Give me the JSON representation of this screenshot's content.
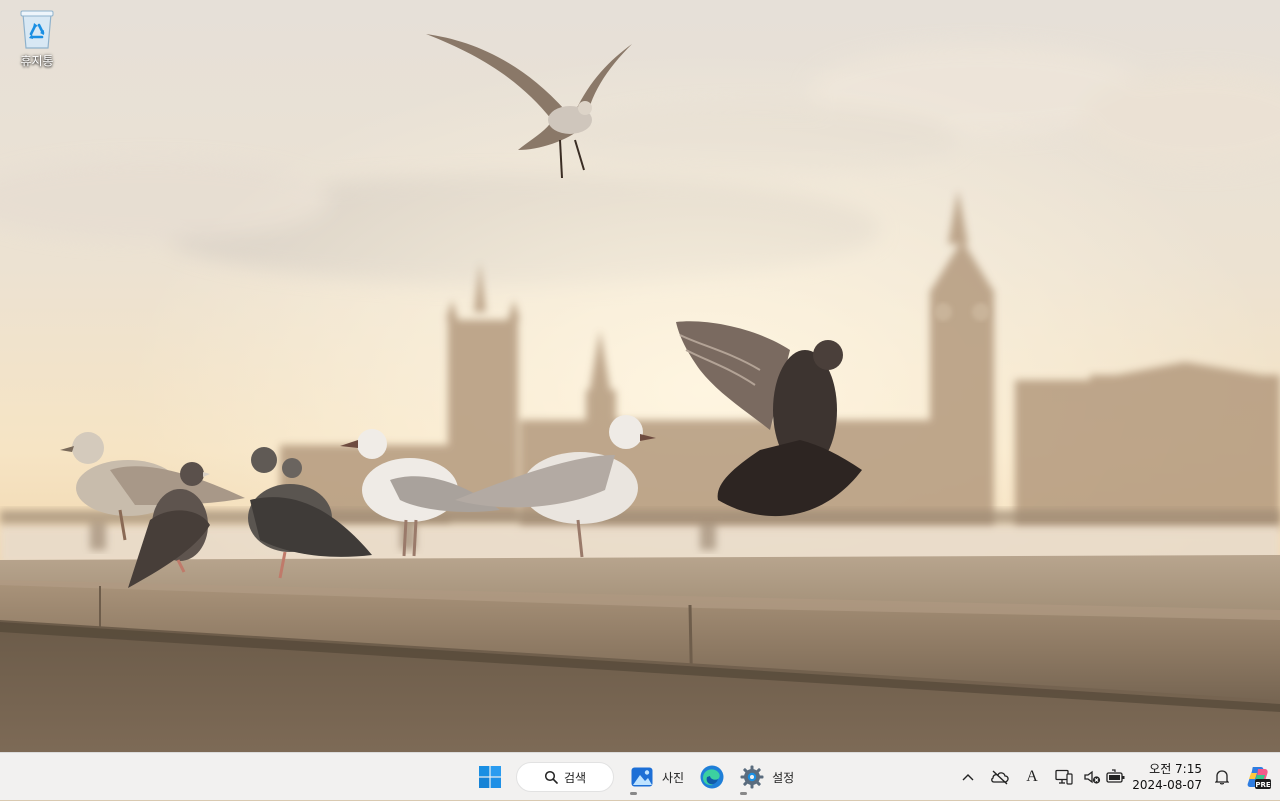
{
  "desktop": {
    "icons": [
      {
        "label": "휴지통",
        "icon": "recycle-bin-icon"
      }
    ],
    "wallpaper": {
      "subject": "pigeons-and-seagulls-on-ledge-with-big-ben",
      "sky_color": "#ece4d8",
      "haze_color": "#f6e2c0",
      "ledge_color": "#9a8a78"
    }
  },
  "taskbar": {
    "start_icon": "windows-start-icon",
    "search": {
      "label": "검색",
      "icon": "search-icon"
    },
    "apps": [
      {
        "label": "사진",
        "icon": "photos-icon",
        "running": true
      },
      {
        "label": "",
        "icon": "edge-icon",
        "running": false
      },
      {
        "label": "설정",
        "icon": "settings-gear-icon",
        "running": true
      }
    ],
    "tray": {
      "icons": [
        "chevron-up-icon",
        "onedrive-offline-icon",
        "input-method-icon",
        "network-icon",
        "volume-muted-icon",
        "battery-icon"
      ],
      "input_method_glyph": "A",
      "clock": {
        "time": "오전 7:15",
        "date": "2024-08-07"
      },
      "notification_icon": "bell-icon",
      "copilot_icon": "copilot-icon",
      "copilot_badge": "PRE"
    },
    "colors": {
      "background": "#f2f1f0",
      "windows_blue": "#1a8fe3"
    }
  }
}
